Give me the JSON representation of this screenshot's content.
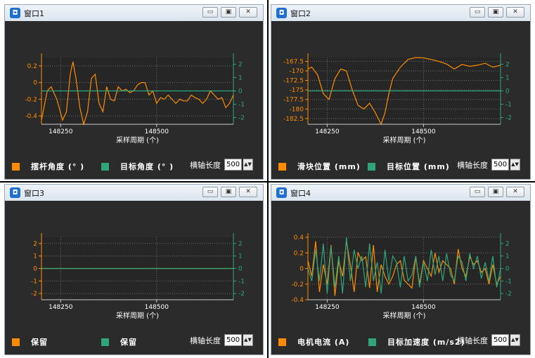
{
  "colors": {
    "orange": "#ff8c00",
    "green": "#2ea67a",
    "plot_bg": "#262626",
    "ref_line_orange": "#c8c8c8",
    "ref_line_green": "#3bbf86"
  },
  "axis_length": {
    "label": "横轴长度",
    "value": "500",
    "spin_icon": "spin-arrows-icon"
  },
  "common": {
    "xlabel": "采样周期 (个)"
  },
  "windows": [
    {
      "title": "窗口1",
      "legend": {
        "left": "摆杆角度 (° )",
        "right": "目标角度 (° )"
      },
      "chart": {
        "type": "line",
        "x_ticks": [
          "148250",
          "148500"
        ],
        "left_ticks": [
          "0.2",
          "0",
          "-0.2",
          "-0.4"
        ],
        "right_ticks": [
          "2",
          "1",
          "0",
          "-1",
          "-2"
        ],
        "left_range": [
          -0.5,
          0.3
        ],
        "right_range": [
          -2.5,
          2.5
        ]
      }
    },
    {
      "title": "窗口2",
      "legend": {
        "left": "滑块位置 (mm)",
        "right": "目标位置 (mm)"
      },
      "chart": {
        "type": "line",
        "x_ticks": [
          "148250",
          "148500"
        ],
        "left_ticks": [
          "-167.5",
          "-170",
          "-172.5",
          "-175",
          "-177.5",
          "-180",
          "-182.5"
        ],
        "right_ticks": [
          "2",
          "1",
          "0",
          "-1",
          "-2"
        ],
        "left_range": [
          -184,
          -166.5
        ],
        "right_range": [
          -2.5,
          2.5
        ]
      }
    },
    {
      "title": "窗口3",
      "legend": {
        "left": "保留",
        "right": "保留"
      },
      "chart": {
        "type": "line",
        "x_ticks": [
          "148250",
          "148500"
        ],
        "left_ticks": [
          "2",
          "1",
          "0",
          "-1",
          "-2"
        ],
        "right_ticks": [
          "2",
          "1",
          "0",
          "-1",
          "-2"
        ],
        "left_range": [
          -2.5,
          2.5
        ],
        "right_range": [
          -2.5,
          2.5
        ]
      }
    },
    {
      "title": "窗口4",
      "legend": {
        "left": "电机电流 (A)",
        "right": "目标加速度 (m/s2)"
      },
      "chart": {
        "type": "line",
        "x_ticks": [
          "148250",
          "148500"
        ],
        "left_ticks": [
          "0.4",
          "0.2",
          "0",
          "-0.2",
          "-0.4"
        ],
        "right_ticks": [
          "2",
          "1",
          "0",
          "-1",
          "-2"
        ],
        "left_range": [
          -0.4,
          0.4
        ],
        "right_range": [
          -2.5,
          2.5
        ]
      }
    }
  ],
  "chart_data": [
    {
      "type": "line",
      "xlabel": "采样周期 (个)",
      "x_range": [
        148200,
        148700
      ],
      "series": [
        {
          "name": "摆杆角度 (° )",
          "axis": "left",
          "color": "#ff8c00",
          "x": [
            148200,
            148215,
            148225,
            148240,
            148255,
            148265,
            148275,
            148282,
            148290,
            148300,
            148310,
            148320,
            148330,
            148340,
            148350,
            148360,
            148370,
            148380,
            148390,
            148400,
            148410,
            148420,
            148430,
            148440,
            148450,
            148460,
            148470,
            148480,
            148490,
            148500,
            148510,
            148520,
            148530,
            148540,
            148550,
            148560,
            148570,
            148580,
            148590,
            148600,
            148610,
            148620,
            148630,
            148640,
            148650,
            148660,
            148670,
            148680,
            148690,
            148700
          ],
          "y": [
            -0.45,
            -0.1,
            -0.05,
            -0.2,
            -0.45,
            -0.35,
            0.1,
            0.25,
            0.05,
            -0.3,
            -0.5,
            -0.35,
            0.05,
            0.1,
            -0.25,
            -0.35,
            -0.05,
            -0.2,
            -0.22,
            -0.05,
            -0.1,
            -0.08,
            -0.12,
            -0.1,
            -0.03,
            0.0,
            0.0,
            -0.15,
            -0.1,
            -0.25,
            -0.18,
            -0.2,
            -0.15,
            -0.2,
            -0.25,
            -0.2,
            -0.22,
            -0.22,
            -0.15,
            -0.18,
            -0.2,
            -0.25,
            -0.2,
            -0.1,
            -0.15,
            -0.2,
            -0.18,
            -0.3,
            -0.25,
            -0.15
          ]
        },
        {
          "name": "目标角度 (° )",
          "axis": "right",
          "color": "#2ea67a",
          "x": [
            148200,
            148700
          ],
          "y": [
            0,
            0
          ]
        }
      ]
    },
    {
      "type": "line",
      "xlabel": "采样周期 (个)",
      "x_range": [
        148200,
        148700
      ],
      "series": [
        {
          "name": "滑块位置 (mm)",
          "axis": "left",
          "color": "#ff8c00",
          "x": [
            148200,
            148210,
            148225,
            148240,
            148255,
            148270,
            148285,
            148300,
            148315,
            148330,
            148345,
            148360,
            148375,
            148390,
            148400,
            148410,
            148420,
            148440,
            148460,
            148480,
            148500,
            148520,
            148540,
            148560,
            148580,
            148600,
            148620,
            148640,
            148660,
            148680,
            148700
          ],
          "y": [
            -169.5,
            -169,
            -171,
            -176,
            -177.5,
            -172,
            -169.5,
            -170,
            -175,
            -179,
            -180,
            -178.5,
            -181,
            -184,
            -181,
            -176,
            -172,
            -169,
            -167,
            -166.5,
            -166.6,
            -167,
            -167.5,
            -168.2,
            -169.5,
            -168.3,
            -168.8,
            -168.5,
            -168,
            -169,
            -168.5
          ]
        },
        {
          "name": "目标位置 (mm)",
          "axis": "right",
          "color": "#2ea67a",
          "x": [
            148200,
            148700
          ],
          "y": [
            0,
            0
          ]
        }
      ]
    },
    {
      "type": "line",
      "xlabel": "采样周期 (个)",
      "x_range": [
        148200,
        148700
      ],
      "series": [
        {
          "name": "保留",
          "axis": "left",
          "color": "#ff8c00",
          "x": [
            148200,
            148700
          ],
          "y": [
            0,
            0
          ]
        },
        {
          "name": "保留",
          "axis": "right",
          "color": "#2ea67a",
          "x": [
            148200,
            148700
          ],
          "y": [
            0,
            0
          ]
        }
      ]
    },
    {
      "type": "line",
      "xlabel": "采样周期 (个)",
      "x_range": [
        148200,
        148700
      ],
      "series": [
        {
          "name": "电机电流 (A)",
          "axis": "left",
          "color": "#ff8c00",
          "x": [
            148200,
            148210,
            148220,
            148230,
            148240,
            148250,
            148260,
            148270,
            148280,
            148290,
            148300,
            148310,
            148320,
            148330,
            148340,
            148350,
            148360,
            148370,
            148380,
            148390,
            148400,
            148410,
            148420,
            148430,
            148440,
            148450,
            148460,
            148470,
            148480,
            148490,
            148500,
            148510,
            148520,
            148530,
            148540,
            148550,
            148560,
            148570,
            148580,
            148590,
            148600,
            148610,
            148620,
            148630,
            148640,
            148650,
            148660,
            148670,
            148680,
            148690,
            148700
          ],
          "y": [
            0.1,
            -0.1,
            0.35,
            -0.3,
            0.05,
            -0.2,
            0.3,
            -0.35,
            0.1,
            -0.1,
            0.35,
            0.05,
            -0.3,
            0.2,
            0.1,
            0.15,
            -0.25,
            0.3,
            -0.3,
            0.05,
            -0.1,
            -0.2,
            -0.1,
            0.05,
            0.1,
            -0.15,
            -0.2,
            -0.25,
            0.15,
            -0.2,
            0.1,
            0.0,
            -0.1,
            0.2,
            -0.05,
            0.1,
            0.05,
            0.0,
            -0.2,
            0.25,
            0.0,
            -0.1,
            0.15,
            0.05,
            0.1,
            -0.05,
            0.0,
            -0.2,
            0.05,
            -0.2,
            -0.1
          ]
        },
        {
          "name": "目标加速度 (m/s2)",
          "axis": "right",
          "color": "#2ea67a",
          "x": [
            148200,
            148210,
            148220,
            148230,
            148240,
            148250,
            148260,
            148270,
            148280,
            148290,
            148300,
            148310,
            148320,
            148330,
            148340,
            148350,
            148360,
            148370,
            148380,
            148390,
            148400,
            148410,
            148420,
            148430,
            148440,
            148450,
            148460,
            148470,
            148480,
            148490,
            148500,
            148510,
            148520,
            148530,
            148540,
            148550,
            148560,
            148570,
            148580,
            148590,
            148600,
            148610,
            148620,
            148630,
            148640,
            148650,
            148660,
            148670,
            148680,
            148690,
            148700
          ],
          "y": [
            0,
            -1,
            1.5,
            -1,
            2,
            -2,
            1.8,
            -1.5,
            1,
            -2,
            2.5,
            -1,
            1.5,
            0,
            1,
            -1.5,
            2,
            -1,
            0.5,
            -2,
            1.5,
            -1,
            1,
            0.5,
            -1.5,
            1,
            -1,
            -0.5,
            1,
            -1.5,
            0.5,
            -1,
            1.5,
            -0.5,
            1,
            -1,
            1.2,
            -0.5,
            -1,
            1,
            0.5,
            -1,
            1.2,
            0,
            1,
            -0.8,
            0.5,
            -1,
            1,
            -1.5,
            0
          ]
        }
      ]
    }
  ]
}
